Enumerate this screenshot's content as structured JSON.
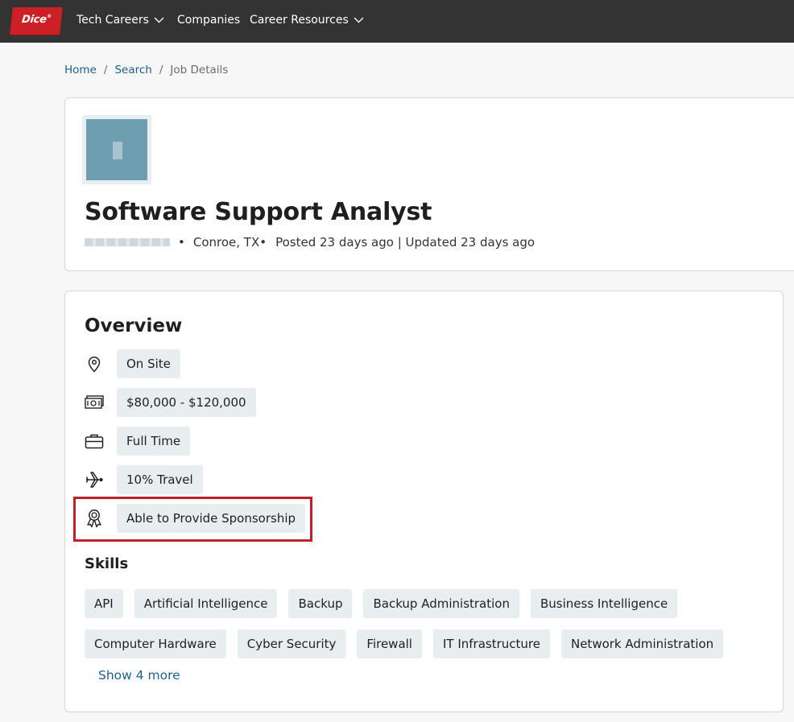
{
  "nav": {
    "logo_text": "Dice",
    "logo_mark": "®",
    "items": [
      {
        "label": "Tech Careers",
        "dropdown": true
      },
      {
        "label": "Companies",
        "dropdown": false
      },
      {
        "label": "Career Resources",
        "dropdown": true
      }
    ]
  },
  "breadcrumb": {
    "items": [
      "Home",
      "Search",
      "Job Details"
    ],
    "separator": "/"
  },
  "job": {
    "title": "Software Support Analyst",
    "location": "Conroe, TX",
    "bullet": "•",
    "posted": "Posted 23 days ago | Updated 23 days ago"
  },
  "overview": {
    "title": "Overview",
    "items": [
      {
        "icon": "location-pin-icon",
        "label": "On Site"
      },
      {
        "icon": "money-icon",
        "label": "$80,000 - $120,000"
      },
      {
        "icon": "briefcase-icon",
        "label": "Full Time"
      },
      {
        "icon": "airplane-icon",
        "label": "10% Travel"
      },
      {
        "icon": "award-ribbon-icon",
        "label": "Able to Provide Sponsorship"
      }
    ]
  },
  "skills": {
    "title": "Skills",
    "items": [
      "API",
      "Artificial Intelligence",
      "Backup",
      "Backup Administration",
      "Business Intelligence",
      "Computer Hardware",
      "Cyber Security",
      "Firewall",
      "IT Infrastructure",
      "Network Administration"
    ],
    "show_more": "Show 4 more"
  },
  "colors": {
    "nav_bg": "#333333",
    "logo_red": "#cc1f26",
    "link_blue": "#1f5f8b",
    "chip_bg": "#e8eef0",
    "highlight_red": "#c0202a"
  }
}
